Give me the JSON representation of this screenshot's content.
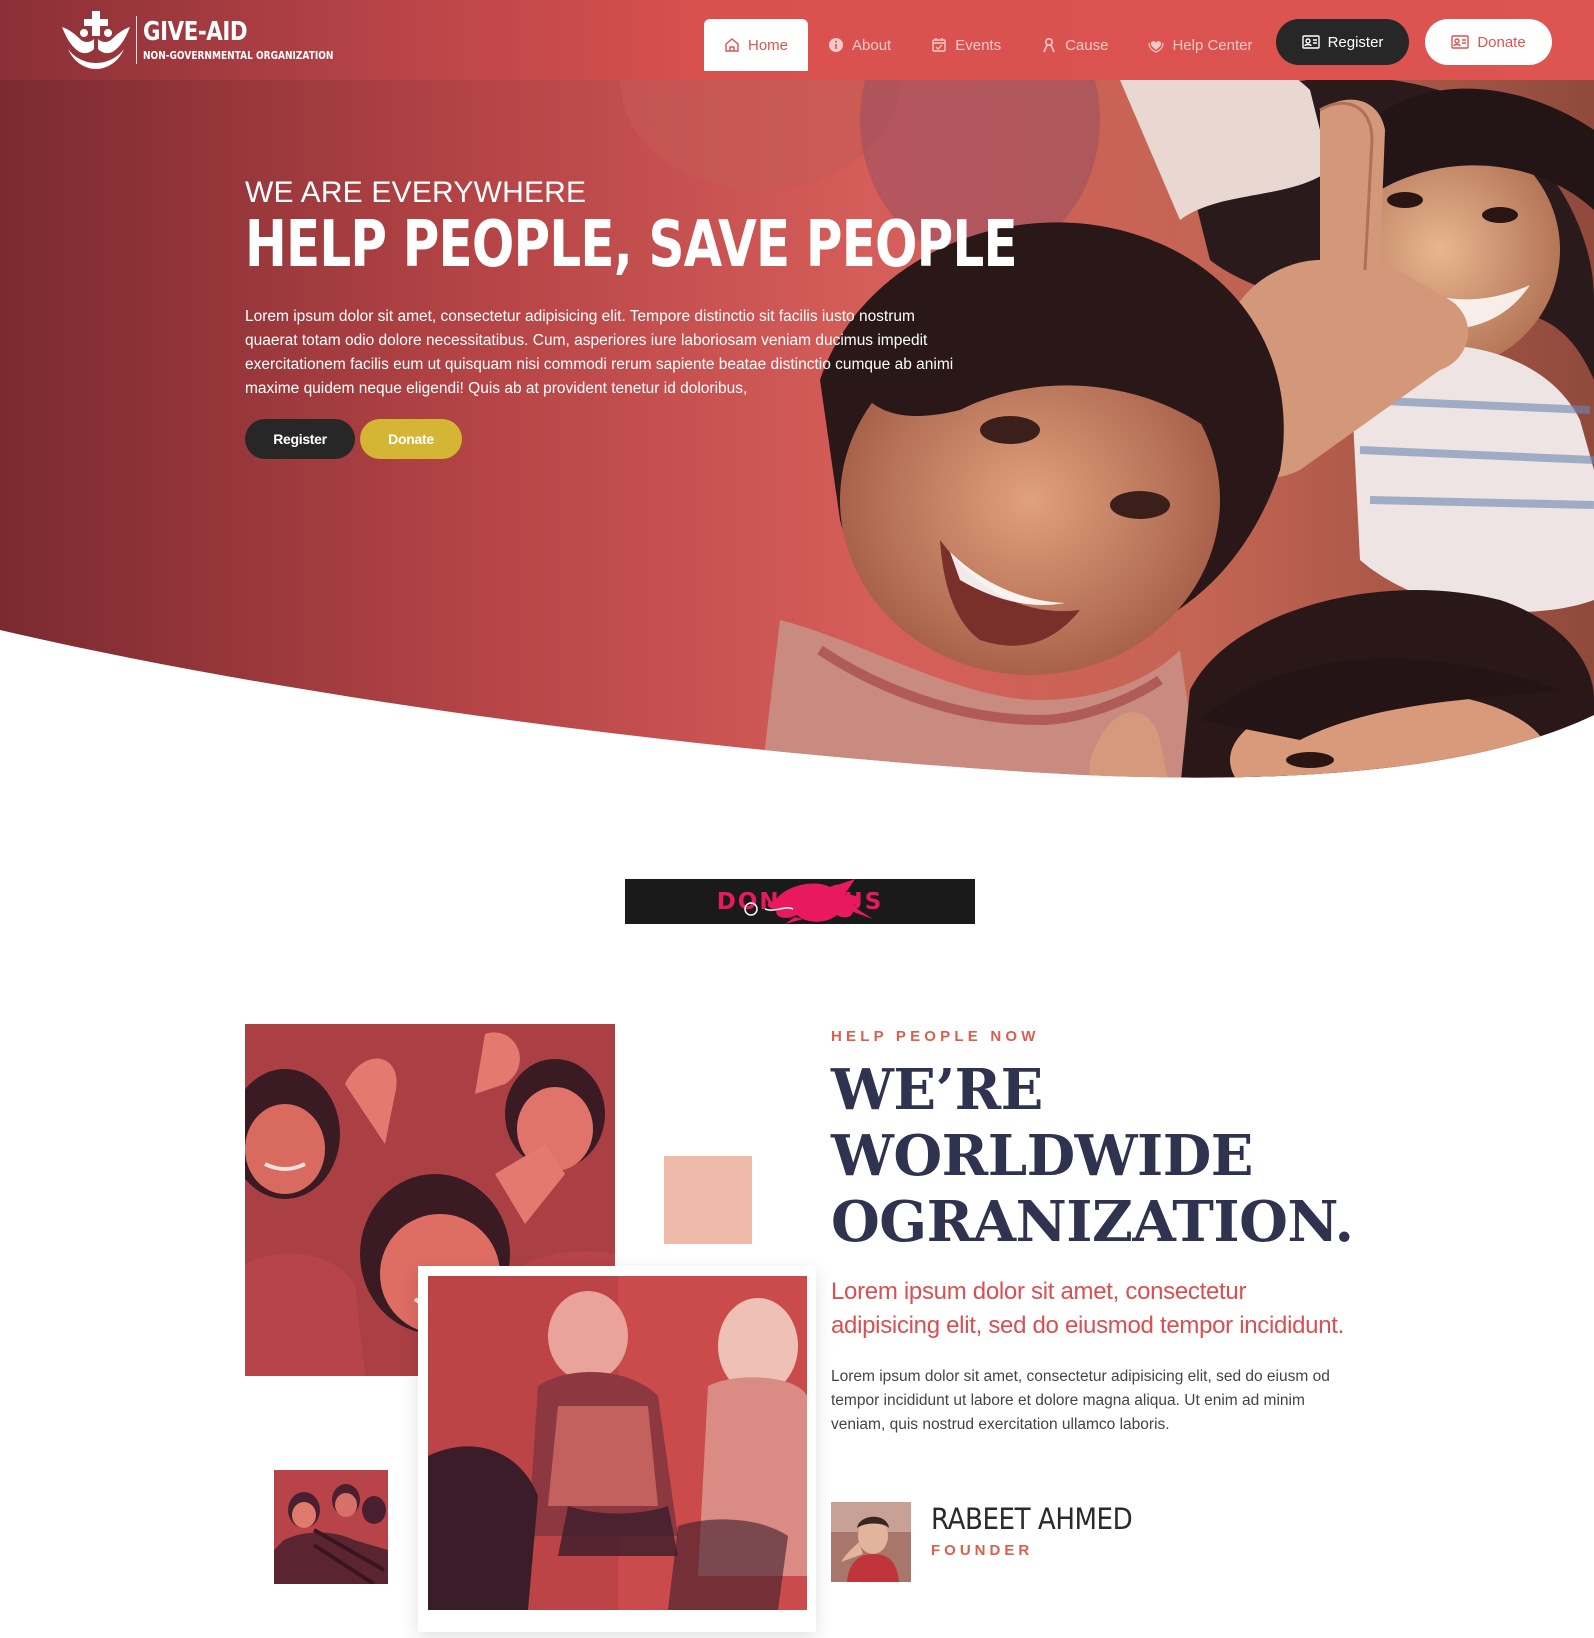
{
  "brand": {
    "name": "GIVE-AID",
    "tagline": "NON-GOVERNMENTAL ORGANIZATION"
  },
  "nav": {
    "items": [
      {
        "label": "Home",
        "icon": "home-icon",
        "active": true
      },
      {
        "label": "About",
        "icon": "info-icon",
        "active": false
      },
      {
        "label": "Events",
        "icon": "calendar-icon",
        "active": false
      },
      {
        "label": "Cause",
        "icon": "ribbon-icon",
        "active": false
      },
      {
        "label": "Help Center",
        "icon": "heart-hands-icon",
        "active": false
      }
    ],
    "register_label": "Register",
    "donate_label": "Donate"
  },
  "hero": {
    "kicker": "WE ARE EVERYWHERE",
    "title": "HELP PEOPLE, SAVE PEOPLE",
    "text": "Lorem ipsum dolor sit amet, consectetur adipisicing elit. Tempore distinctio sit facilis iusto nostrum quaerat totam odio dolore necessitatibus. Cum, asperiores iure laboriosam veniam ducimus impedit exercitationem facilis eum ut quisquam nisi commodi rerum sapiente beatae distinctio cumque ab animi maxime quidem neque eligendi! Quis ab at provident tenetur id doloribus,",
    "register_label": "Register",
    "donate_label": "Donate"
  },
  "banner": {
    "text": "DONATE US"
  },
  "about": {
    "kicker": "HELP PEOPLE NOW",
    "title_lines": [
      "WE’RE",
      "WORLDWIDE",
      "OGRANIZATION."
    ],
    "lead": "Lorem ipsum dolor sit amet, consectetur adipisicing elit, sed do eiusmod tempor incididunt.",
    "text": "Lorem ipsum dolor sit amet, consectetur adipisicing elit, sed do eiusm od tempor incididunt ut labore et dolore magna aliqua. Ut enim ad minim veniam, quis nostrud exercitation ullamco laboris.",
    "founder_name": "RABEET AHMED",
    "founder_role": "FOUNDER"
  },
  "colors": {
    "primary": "#dc5452",
    "dark": "#272727",
    "accent_yellow": "#d4b634",
    "navy": "#2f3350",
    "peach": "#efbaa9"
  }
}
